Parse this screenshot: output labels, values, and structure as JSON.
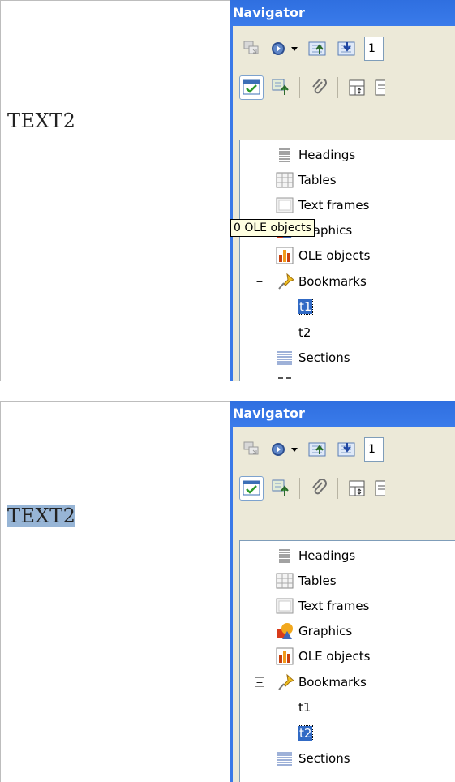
{
  "top": {
    "document_text": "TEXT2",
    "navigator": {
      "title": "Navigator",
      "page_value": "1",
      "items": [
        {
          "label": "Headings",
          "icon": "headings-icon"
        },
        {
          "label": "Tables",
          "icon": "tables-icon"
        },
        {
          "label": "Text frames",
          "icon": "text-frames-icon"
        },
        {
          "label": "Graphics",
          "icon": "graphics-icon"
        },
        {
          "label": "OLE objects",
          "icon": "ole-objects-icon"
        },
        {
          "label": "Bookmarks",
          "icon": "bookmark-icon",
          "expanded": true
        },
        {
          "label": "t1",
          "selected": true
        },
        {
          "label": "t2"
        },
        {
          "label": "Sections",
          "icon": "sections-icon"
        }
      ],
      "tooltip": "0 OLE objects"
    }
  },
  "bottom": {
    "document_text": "TEXT2",
    "document_text_selected": true,
    "navigator": {
      "title": "Navigator",
      "page_value": "1",
      "items": [
        {
          "label": "Headings",
          "icon": "headings-icon"
        },
        {
          "label": "Tables",
          "icon": "tables-icon"
        },
        {
          "label": "Text frames",
          "icon": "text-frames-icon"
        },
        {
          "label": "Graphics",
          "icon": "graphics-icon"
        },
        {
          "label": "OLE objects",
          "icon": "ole-objects-icon"
        },
        {
          "label": "Bookmarks",
          "icon": "bookmark-icon",
          "expanded": true
        },
        {
          "label": "t1"
        },
        {
          "label": "t2",
          "selected": true
        },
        {
          "label": "Sections",
          "icon": "sections-icon"
        }
      ]
    }
  }
}
